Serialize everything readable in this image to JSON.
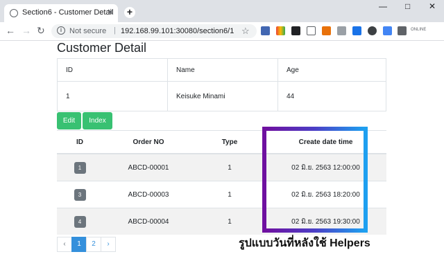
{
  "browser": {
    "tab_title": "Section6 - Customer Detail",
    "tab_close": "✕",
    "new_tab": "+",
    "win_minimize": "—",
    "win_maximize": "□",
    "win_close": "✕",
    "back": "←",
    "forward": "→",
    "reload": "↻",
    "info_glyph": "i",
    "not_secure": "Not secure",
    "separator": "|",
    "url": "192.168.99.101:30080/section6/1",
    "bookmark": "☆",
    "extensions_menu": "✚",
    "last_ext_label": "ONLINE",
    "icons": [
      "globe-icon",
      "star-icon",
      "chrome-icon",
      "film-icon",
      "tab-icon",
      "copy-icon",
      "grid-icon",
      "s-logo-icon",
      "circle-icon",
      "translate-icon",
      "puzzle-icon",
      "online-icon"
    ]
  },
  "page": {
    "title": "Customer Detail",
    "customer_table": {
      "headers": [
        "ID",
        "Name",
        "Age"
      ],
      "row": [
        "1",
        "Keisuke Minami",
        "44"
      ]
    },
    "buttons": {
      "edit": "Edit",
      "index": "Index"
    },
    "orders_table": {
      "headers": [
        "ID",
        "Order NO",
        "Type",
        "Create date time"
      ],
      "rows": [
        {
          "id": "1",
          "order_no": "ABCD-00001",
          "type": "1",
          "created": "02 มิ.ย. 2563 12:00:00"
        },
        {
          "id": "3",
          "order_no": "ABCD-00003",
          "type": "1",
          "created": "02 มิ.ย. 2563 18:20:00"
        },
        {
          "id": "4",
          "order_no": "ABCD-00004",
          "type": "1",
          "created": "02 มิ.ย. 2563 19:30:00"
        }
      ]
    },
    "pagination": {
      "prev": "‹",
      "pages": [
        "1",
        "2"
      ],
      "next": "›",
      "active_page": "1"
    },
    "annotation_caption": "รูปแบบวันที่หลังใช้ Helpers",
    "colors": {
      "success": "#38c172",
      "primary": "#3490dc",
      "badge": "#6c757d",
      "highlight_start": "#6f10a0",
      "highlight_end": "#1ea0f0"
    }
  }
}
